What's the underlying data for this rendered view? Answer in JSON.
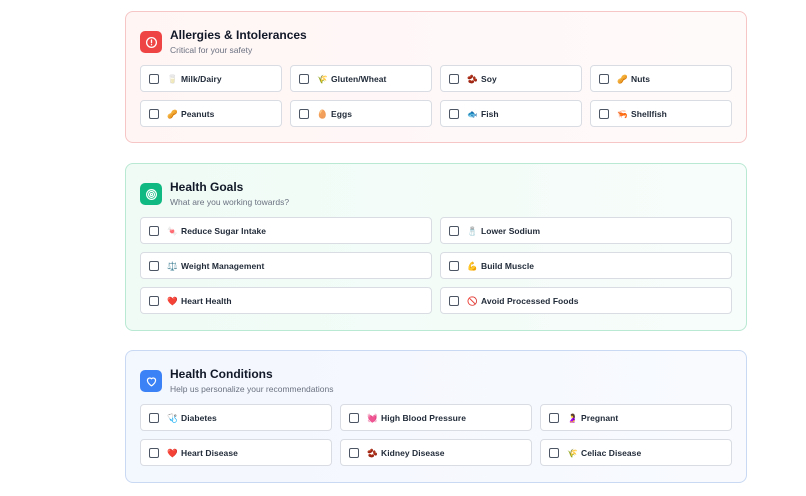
{
  "colors": {
    "allergies_accent": "#ef4444",
    "goals_accent": "#10b981",
    "conditions_accent": "#3b82f6"
  },
  "allergies": {
    "title": "Allergies & Intolerances",
    "subtitle": "Critical for your safety",
    "icon": "alert-circle-icon",
    "options": [
      {
        "emoji": "🥛",
        "label": "Milk/Dairy"
      },
      {
        "emoji": "🌾",
        "label": "Gluten/Wheat"
      },
      {
        "emoji": "🫘",
        "label": "Soy"
      },
      {
        "emoji": "🥜",
        "label": "Nuts"
      },
      {
        "emoji": "🥜",
        "label": "Peanuts"
      },
      {
        "emoji": "🥚",
        "label": "Eggs"
      },
      {
        "emoji": "🐟",
        "label": "Fish"
      },
      {
        "emoji": "🦐",
        "label": "Shellfish"
      }
    ]
  },
  "goals": {
    "title": "Health Goals",
    "subtitle": "What are you working towards?",
    "icon": "target-icon",
    "options": [
      {
        "emoji": "🍬",
        "label": "Reduce Sugar Intake"
      },
      {
        "emoji": "🧂",
        "label": "Lower Sodium"
      },
      {
        "emoji": "⚖️",
        "label": "Weight Management"
      },
      {
        "emoji": "💪",
        "label": "Build Muscle"
      },
      {
        "emoji": "❤️",
        "label": "Heart Health"
      },
      {
        "emoji": "🚫",
        "label": "Avoid Processed Foods"
      }
    ]
  },
  "conditions": {
    "title": "Health Conditions",
    "subtitle": "Help us personalize your recommendations",
    "icon": "heart-outline-icon",
    "options": [
      {
        "emoji": "🩺",
        "label": "Diabetes"
      },
      {
        "emoji": "💓",
        "label": "High Blood Pressure"
      },
      {
        "emoji": "🤰",
        "label": "Pregnant"
      },
      {
        "emoji": "❤️",
        "label": "Heart Disease"
      },
      {
        "emoji": "🫘",
        "label": "Kidney Disease"
      },
      {
        "emoji": "🌾",
        "label": "Celiac Disease"
      }
    ]
  }
}
